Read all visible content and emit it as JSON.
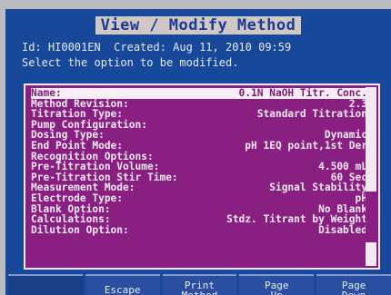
{
  "header": {
    "title": "View / Modify Method",
    "id_label": "Id: HI0001EN",
    "created": "Created: Aug 11, 2010 09:59",
    "instruction": "Select the option to be modified."
  },
  "list": {
    "items": [
      {
        "label": "Name:",
        "value": "0.1N NaOH Titr. Conc.",
        "selected": true
      },
      {
        "label": "Method Revision:",
        "value": "2.3"
      },
      {
        "label": "Titration Type:",
        "value": "Standard Titration"
      },
      {
        "label": "Pump Configuration:",
        "value": ""
      },
      {
        "label": "Dosing Type:",
        "value": "Dynamic"
      },
      {
        "label": "End Point Mode:",
        "value": "pH 1EQ point,1st Der"
      },
      {
        "label": "Recognition Options:",
        "value": ""
      },
      {
        "label": "Pre-Titration Volume:",
        "value": "4.500 mL"
      },
      {
        "label": "Pre-Titration Stir Time:",
        "value": "60 Sec"
      },
      {
        "label": "Measurement Mode:",
        "value": "Signal Stability"
      },
      {
        "label": "Electrode Type:",
        "value": "pH"
      },
      {
        "label": "Blank Option:",
        "value": "No Blank"
      },
      {
        "label": "Calculations:",
        "value": "Stdz. Titrant by Weight"
      },
      {
        "label": "Dilution Option:",
        "value": "Disabled"
      }
    ]
  },
  "scrollbar": {
    "position_fraction": 0.6
  },
  "softkeys": [
    {
      "label": "",
      "name": "softkey-blank"
    },
    {
      "label": "Escape",
      "name": "escape-softkey"
    },
    {
      "label": "Print\nMethod",
      "name": "print-method-softkey"
    },
    {
      "label": "Page\nUp",
      "name": "page-up-softkey"
    },
    {
      "label": "Page\nDown",
      "name": "page-down-softkey"
    }
  ]
}
